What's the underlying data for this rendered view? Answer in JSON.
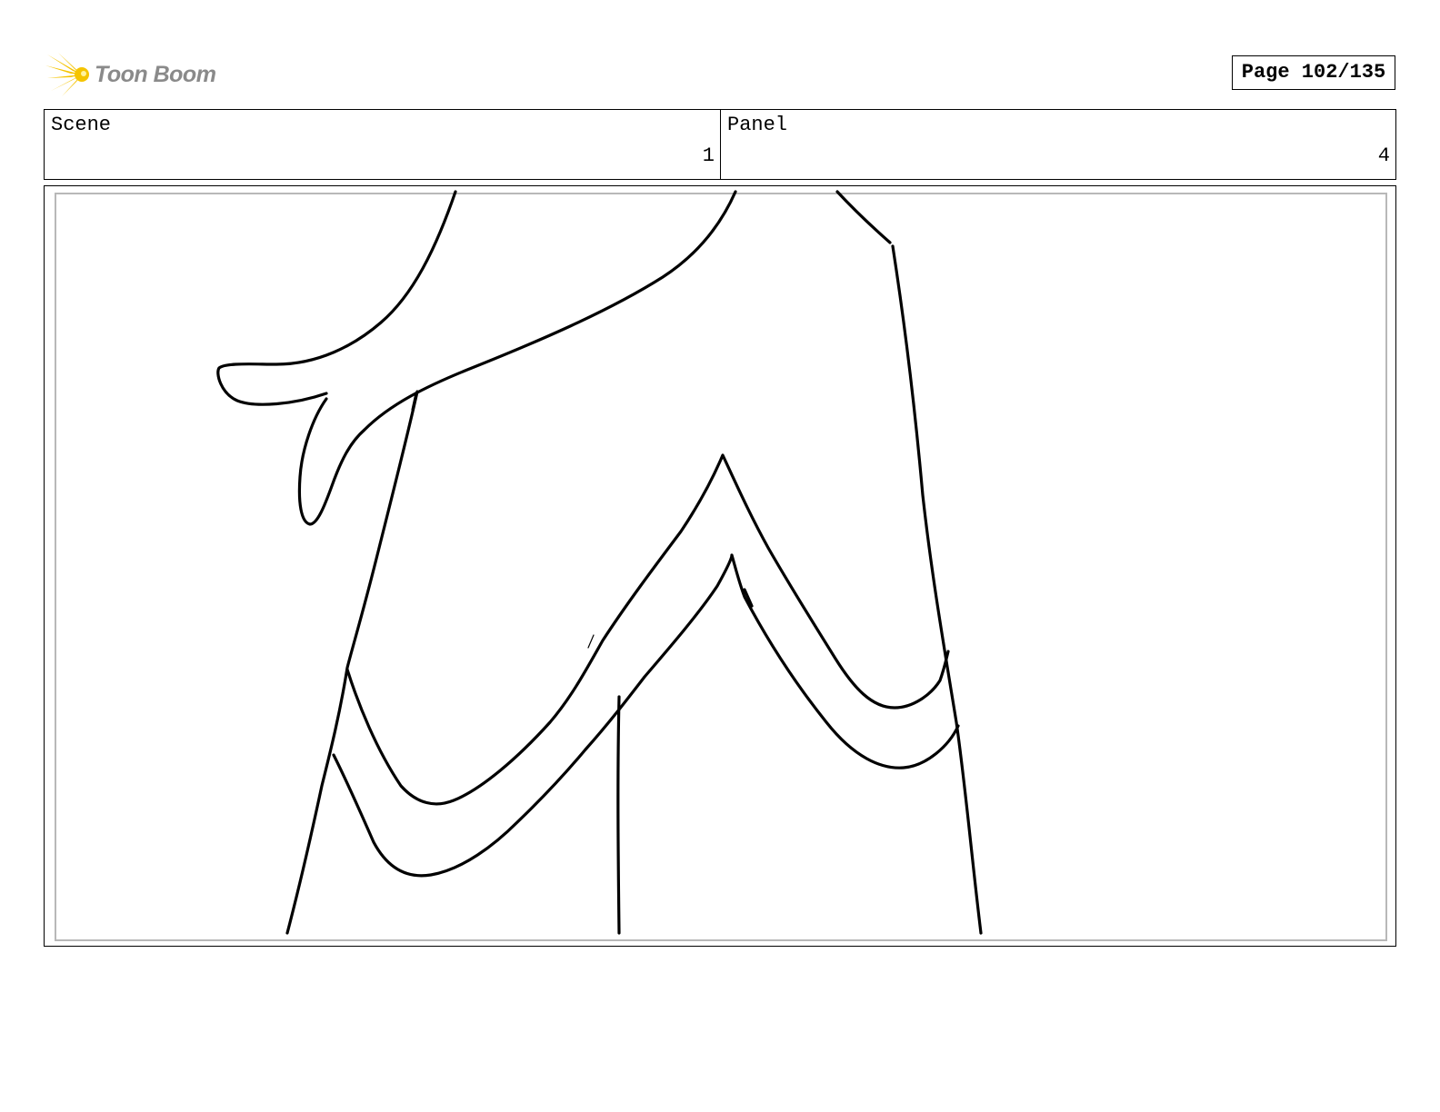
{
  "header": {
    "logo_text": "Toon Boom",
    "page_indicator": "Page 102/135"
  },
  "info": {
    "scene_label": "Scene",
    "scene_value": "1",
    "panel_label": "Panel",
    "panel_value": "4"
  },
  "colors": {
    "logo_star": "#f5c400",
    "logo_text": "#8a8a8a",
    "frame_inner_border": "#b8b8b8"
  }
}
